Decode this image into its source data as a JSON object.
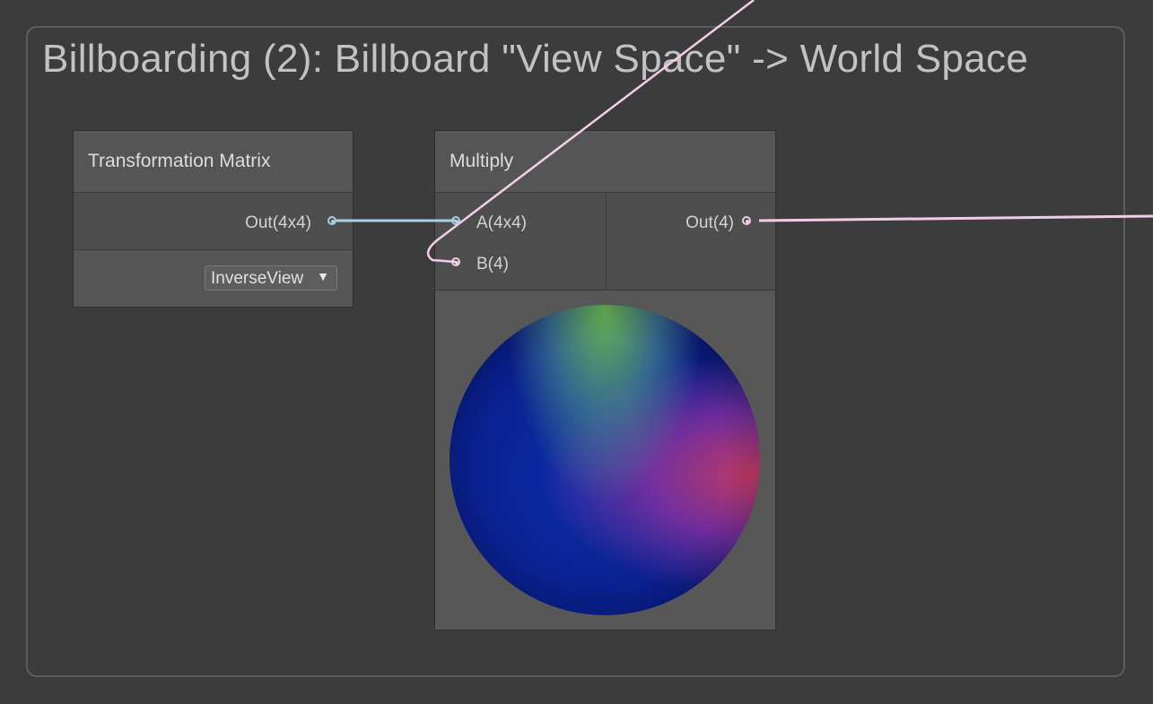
{
  "group": {
    "title": "Billboarding (2): Billboard \"View Space\" -> World Space"
  },
  "transformation_node": {
    "title": "Transformation Matrix",
    "output_label": "Out(4x4)",
    "dropdown_value": "InverseView"
  },
  "multiply_node": {
    "title": "Multiply",
    "input_a_label": "A(4x4)",
    "input_b_label": "B(4)",
    "output_label": "Out(4)"
  },
  "colors": {
    "background": "#3c3c3c",
    "matrix_port": "#a9d0e4",
    "vector4_port": "#f2cde8"
  }
}
